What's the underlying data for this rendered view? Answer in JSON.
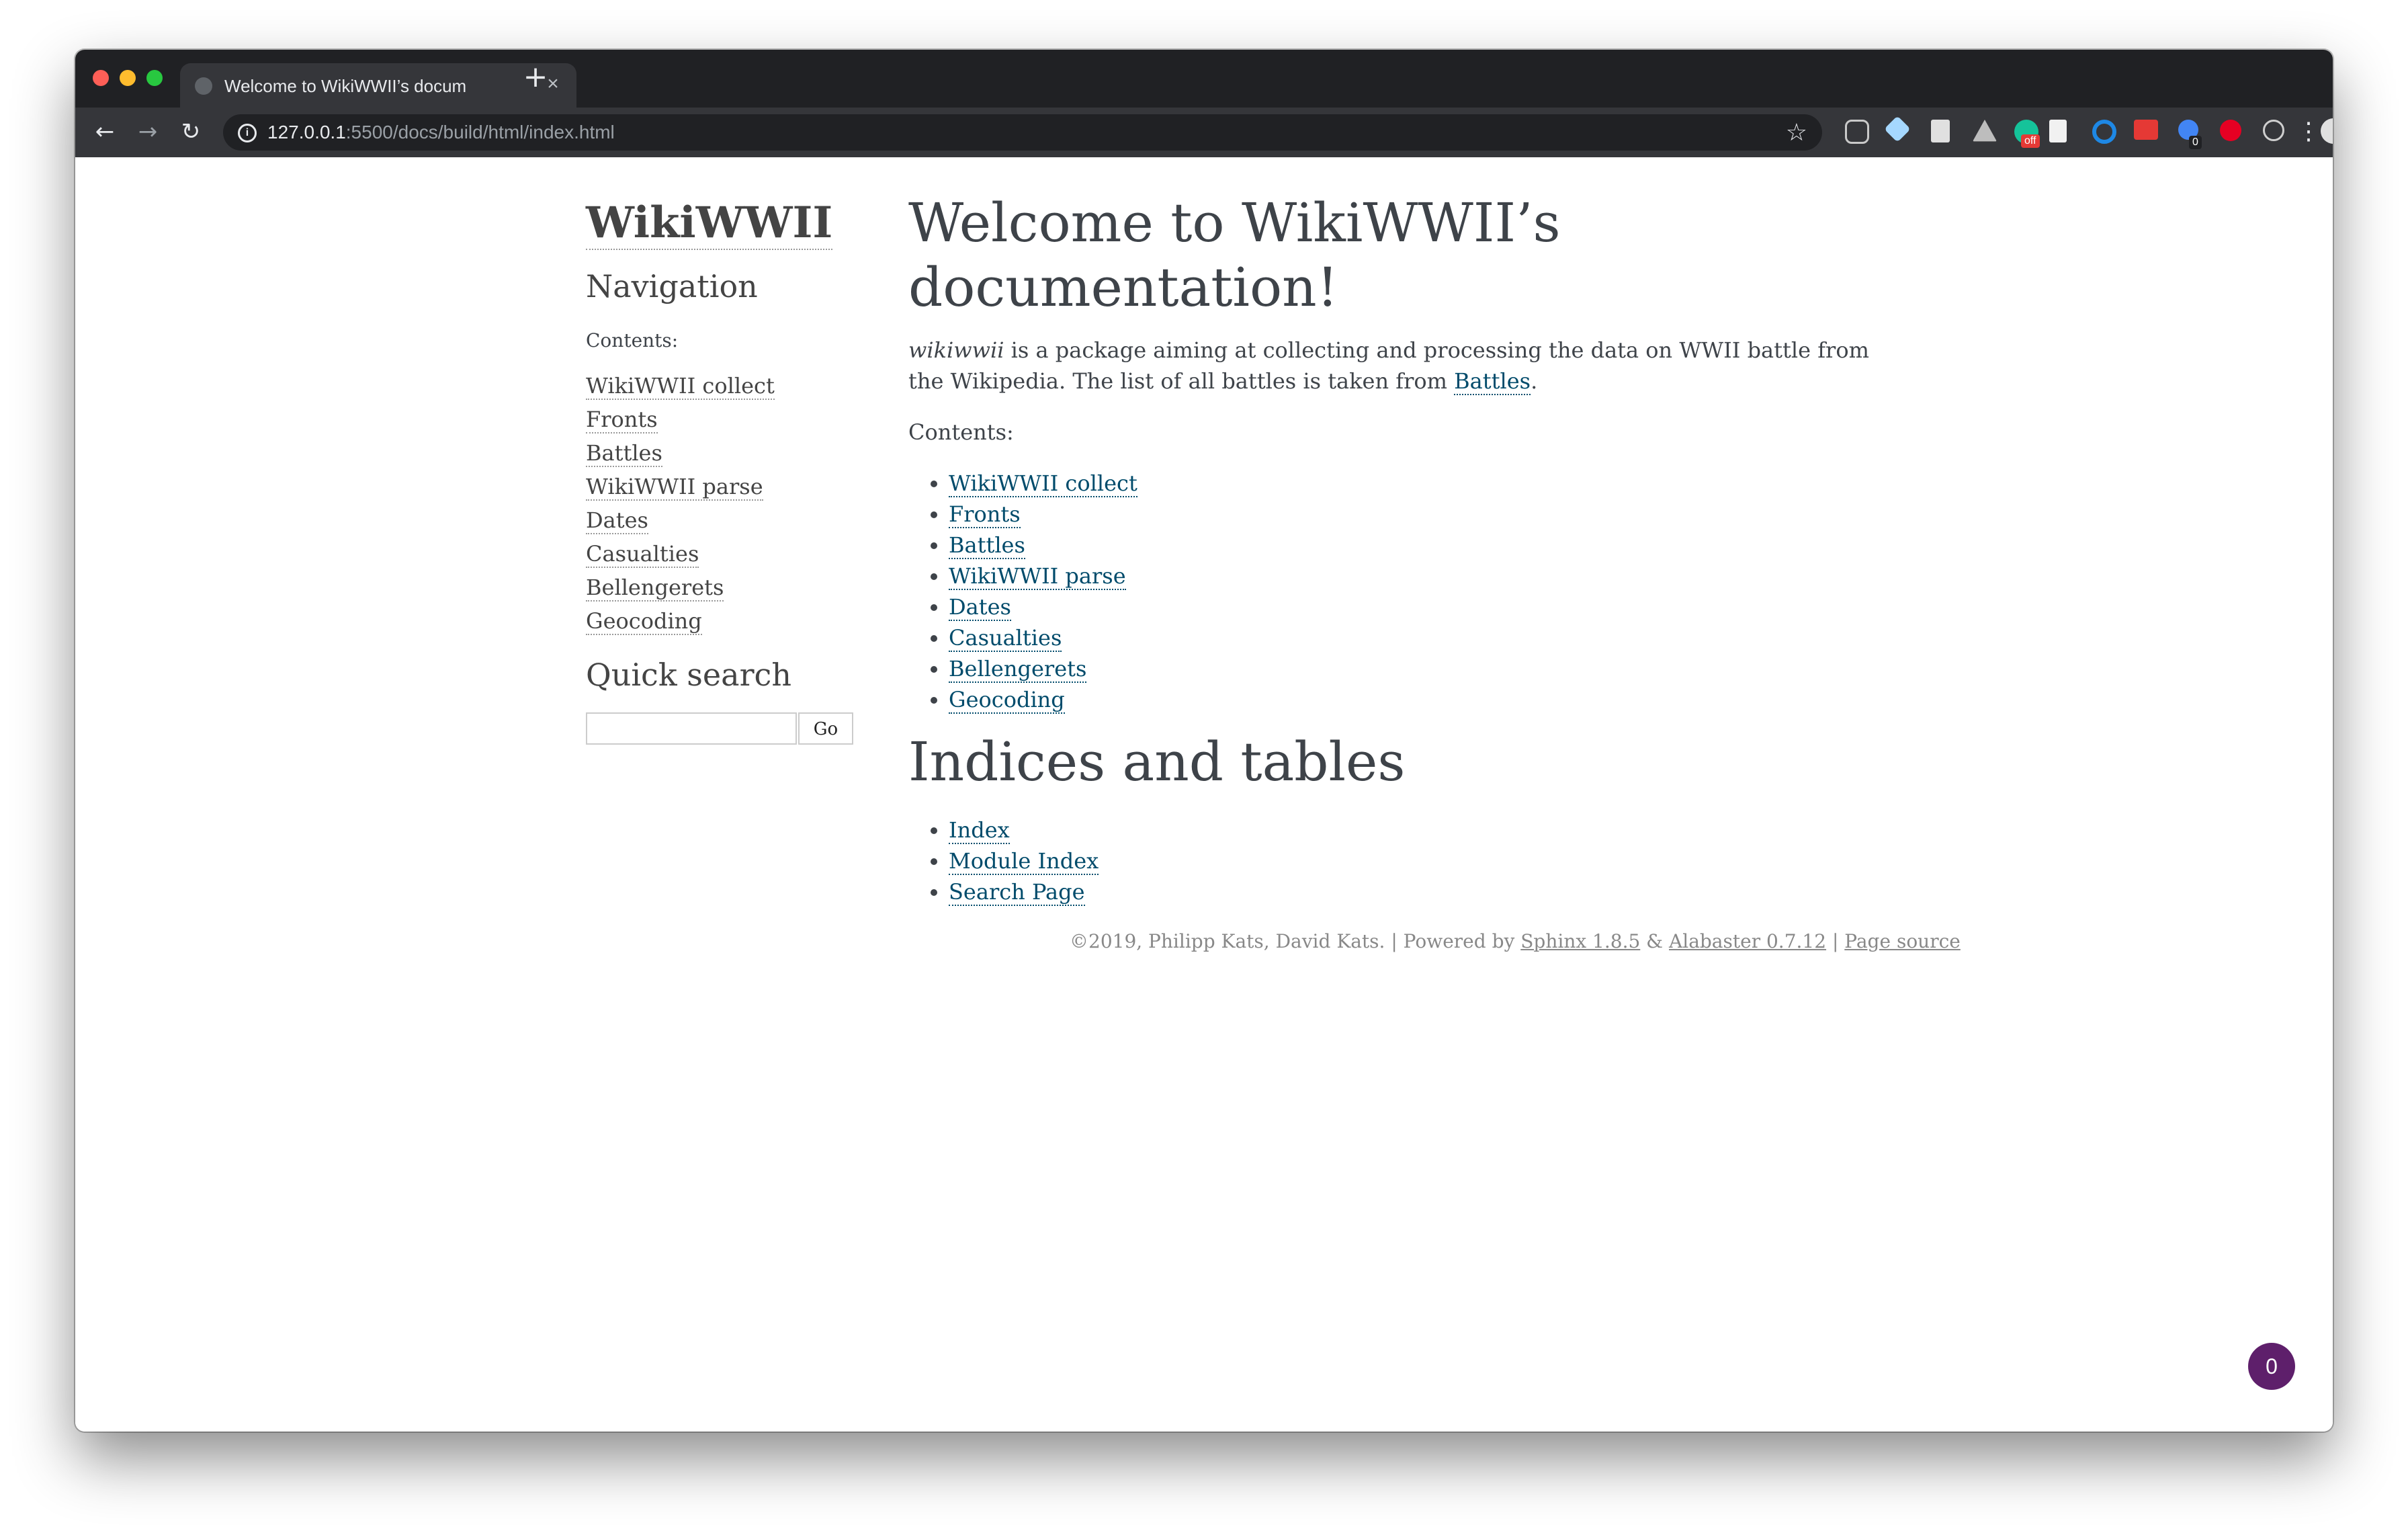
{
  "browser": {
    "tab_title": "Welcome to WikiWWII’s docum",
    "tab_close": "×",
    "new_tab": "+",
    "url_host": "127.0.0.1",
    "url_path": ":5500/docs/build/html/index.html",
    "back": "←",
    "forward": "→",
    "reload": "↻",
    "star": "☆",
    "menu": "⋮",
    "extension_badges": [
      "off",
      "0"
    ]
  },
  "sidebar": {
    "logo": "WikiWWII",
    "navigation_heading": "Navigation",
    "contents_caption": "Contents:",
    "items": [
      {
        "label": "WikiWWII collect"
      },
      {
        "label": "Fronts"
      },
      {
        "label": "Battles"
      },
      {
        "label": "WikiWWII parse"
      },
      {
        "label": "Dates"
      },
      {
        "label": "Casualties"
      },
      {
        "label": "Bellengerets"
      },
      {
        "label": "Geocoding"
      }
    ],
    "quick_search_heading": "Quick search",
    "search_value": "",
    "go_label": "Go"
  },
  "main": {
    "title_line1": "Welcome to WikiWWII’s",
    "title_line2": "documentation!",
    "intro_em": "wikiwwii",
    "intro_text": " is a package aiming at collecting and processing the data on WWII battle from the Wikipedia. The list of all battles is taken from ",
    "intro_link": "Battles",
    "intro_end": ".",
    "contents_label": "Contents:",
    "toc": [
      {
        "label": "WikiWWII collect"
      },
      {
        "label": "Fronts"
      },
      {
        "label": "Battles"
      },
      {
        "label": "WikiWWII parse"
      },
      {
        "label": "Dates"
      },
      {
        "label": "Casualties"
      },
      {
        "label": "Bellengerets"
      },
      {
        "label": "Geocoding"
      }
    ],
    "indices_heading": "Indices and tables",
    "indices": [
      {
        "label": "Index"
      },
      {
        "label": "Module Index"
      },
      {
        "label": "Search Page"
      }
    ]
  },
  "footer": {
    "copyright": "©2019, Philipp Kats, David Kats. | Powered by ",
    "sphinx": "Sphinx 1.8.5",
    "amp": " & ",
    "alabaster": "Alabaster 0.7.12",
    "sep": " | ",
    "page_source": "Page source"
  },
  "badge_count": "0",
  "colors": {
    "link": "#004b6b",
    "text": "#3e4349",
    "chrome_dark": "#202124",
    "badge": "#5e1f6b"
  }
}
